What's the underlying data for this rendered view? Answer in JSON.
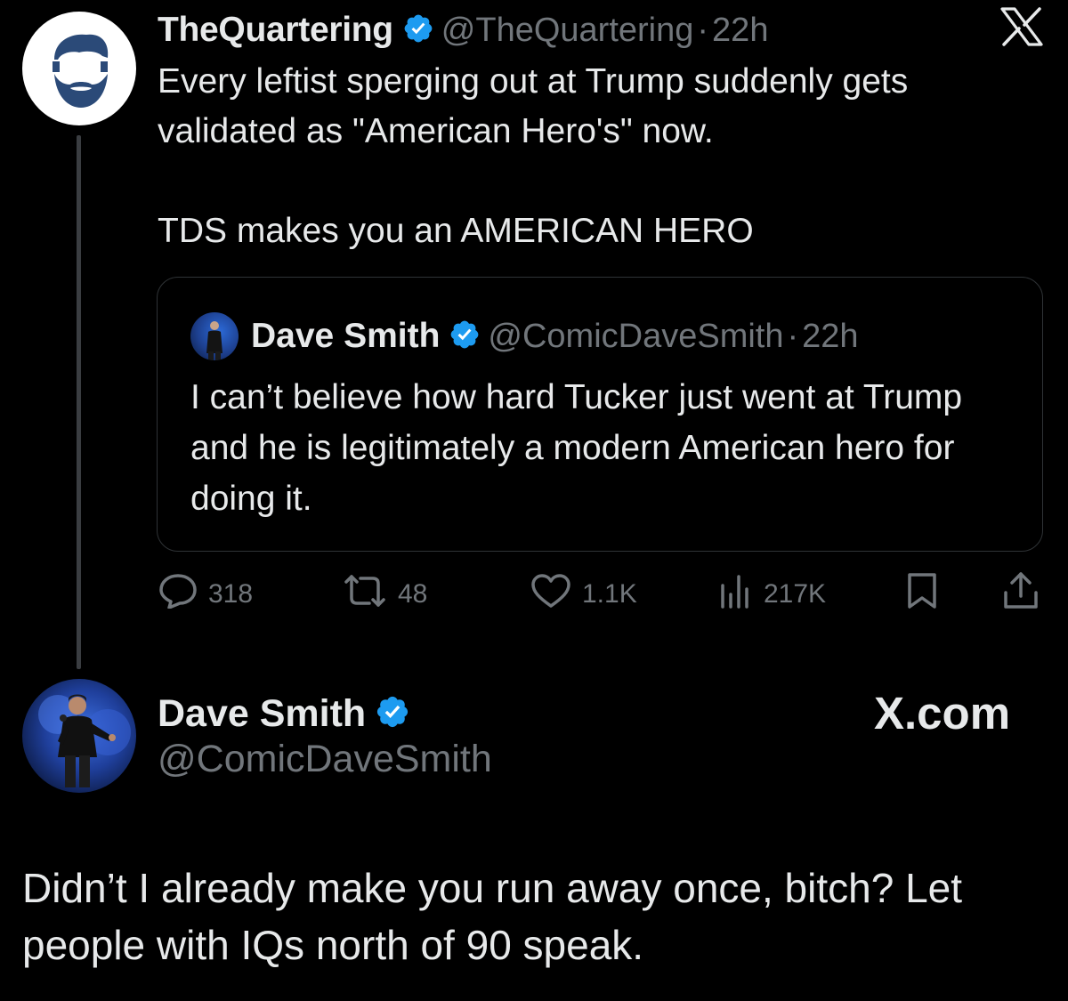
{
  "tweet": {
    "author_name": "TheQuartering",
    "author_handle": "@TheQuartering",
    "separator": "·",
    "time": "22h",
    "text": "Every leftist sperging out at Trump suddenly gets validated as \"American Hero's\" now.\n\nTDS makes you an AMERICAN HERO",
    "verified_icon": "verified-badge-icon",
    "avatar_icon": "bearded-man-logo"
  },
  "quote": {
    "author_name": "Dave Smith",
    "author_handle": "@ComicDaveSmith",
    "separator": "·",
    "time": "22h",
    "text": "I can’t believe how hard Tucker just went at Trump and he is legitimately a modern American hero for doing it."
  },
  "actions": {
    "replies": "318",
    "reposts": "48",
    "likes": "1.1K",
    "views": "217K"
  },
  "reply_post": {
    "author_name": "Dave Smith",
    "author_handle": "@ComicDaveSmith",
    "site": "X.com",
    "text": "Didn’t I already make you run away once, bitch? Let people with IQs north of 90 speak."
  },
  "colors": {
    "background": "#000000",
    "text": "#e7e9ea",
    "muted": "#71767b",
    "verified": "#1d9bf0",
    "border": "#2f3336"
  }
}
